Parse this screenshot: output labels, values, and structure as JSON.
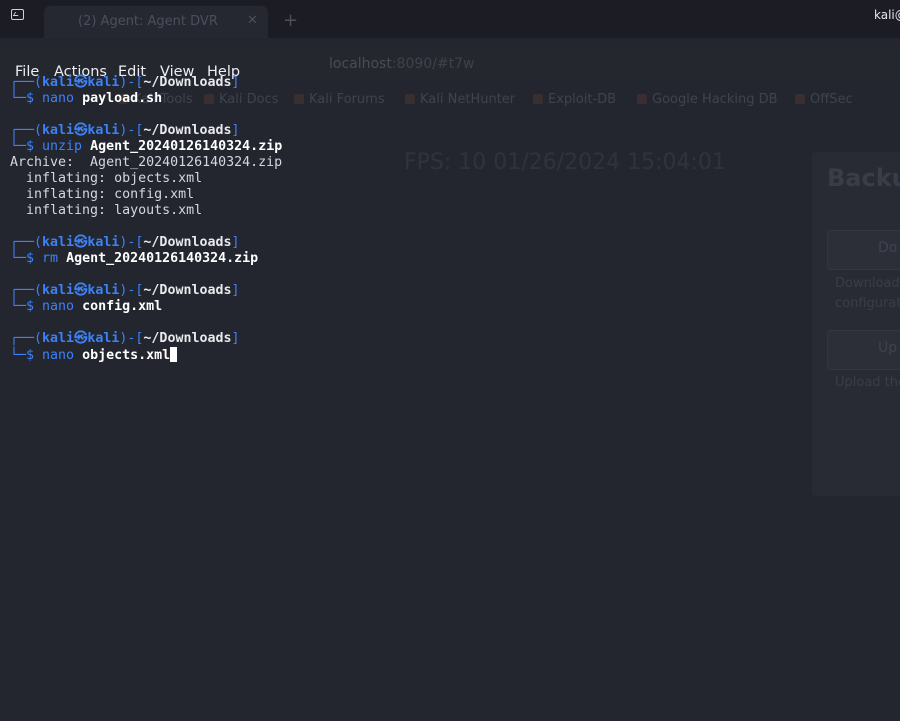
{
  "background_browser": {
    "tab_title": "(2) Agent: Agent DVR",
    "url_host": "localhost",
    "url_rest": ":8090/#t7w",
    "bookmarks": [
      "Kali Tools",
      "Kali Docs",
      "Kali Forums",
      "Kali NetHunter",
      "Exploit-DB",
      "Google Hacking DB",
      "OffSec"
    ],
    "fps_text": "FPS: 10 01/26/2024 15:04:01",
    "panel_title": "Backup",
    "download_label": "Do",
    "upload_label": "Up",
    "download_desc_1": "Download",
    "download_desc_2": "configurati",
    "upload_desc": "Upload the"
  },
  "window": {
    "title": "kali@",
    "icon": "terminal-icon"
  },
  "menu": [
    "File",
    "Actions",
    "Edit",
    "View",
    "Help"
  ],
  "terminal": {
    "prompt": {
      "top_left": "┌──(",
      "user": "kali",
      "at": "㉿",
      "host": "kali",
      "mid": ")-[",
      "path": "~/Downloads",
      "end": "]",
      "bottom": "└─$ "
    },
    "blocks": [
      {
        "cmd": "nano",
        "arg": "payload.sh",
        "output": []
      },
      {
        "cmd": "unzip",
        "arg": "Agent_20240126140324.zip",
        "output": [
          "Archive:  Agent_20240126140324.zip",
          "  inflating: objects.xml",
          "  inflating: config.xml",
          "  inflating: layouts.xml"
        ]
      },
      {
        "cmd": "rm",
        "arg": "Agent_20240126140324.zip",
        "output": []
      },
      {
        "cmd": "nano",
        "arg": "config.xml",
        "output": []
      },
      {
        "cmd": "nano",
        "arg": "objects.xml",
        "output": [],
        "active": true
      }
    ]
  },
  "colors": {
    "prompt_blue": "#3b82f6",
    "background": "#23252e",
    "text": "#d5d7de"
  }
}
